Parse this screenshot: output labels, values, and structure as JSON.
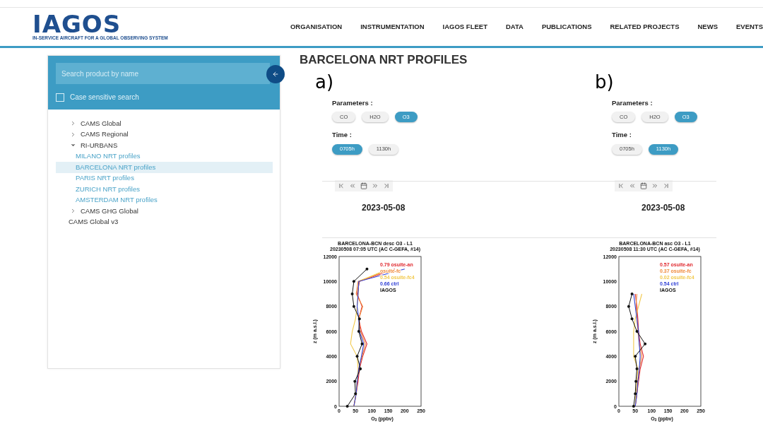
{
  "header": {
    "logo": {
      "name": "IAGOS",
      "tagline": "IN-SERVICE AIRCRAFT FOR A GLOBAL OBSERVING SYSTEM"
    },
    "nav": [
      "ORGANISATION",
      "INSTRUMENTATION",
      "IAGOS FLEET",
      "DATA",
      "PUBLICATIONS",
      "RELATED PROJECTS",
      "NEWS",
      "EVENTS"
    ]
  },
  "sidebar": {
    "search": {
      "placeholder": "Search product by name"
    },
    "case_sensitive": {
      "label": "Case sensitive search",
      "checked": false
    },
    "tree": [
      {
        "label": "CAMS Global",
        "expanded": false,
        "selected": false
      },
      {
        "label": "CAMS Regional",
        "expanded": false,
        "selected": false
      },
      {
        "label": "RI-URBANS",
        "expanded": true,
        "selected": false,
        "children": [
          {
            "label": "MILANO NRT profiles",
            "selected": false
          },
          {
            "label": "BARCELONA NRT profiles",
            "selected": true
          },
          {
            "label": "PARIS NRT profiles",
            "selected": false
          },
          {
            "label": "ZURICH NRT profiles",
            "selected": false
          },
          {
            "label": "AMSTERDAM NRT profiles",
            "selected": false
          }
        ]
      },
      {
        "label": "CAMS GHG Global",
        "expanded": false,
        "selected": false
      },
      {
        "label": "CAMS Global v3",
        "selected": false
      }
    ]
  },
  "page_title": "BARCELONA NRT PROFILES",
  "panels": [
    {
      "label": "a)",
      "parameters_label": "Parameters :",
      "parameters": [
        {
          "label": "CO",
          "selected": false
        },
        {
          "label": "H2O",
          "selected": false
        },
        {
          "label": "O3",
          "selected": true
        }
      ],
      "time_label": "Time :",
      "times": [
        {
          "label": "0705h",
          "selected": true
        },
        {
          "label": "1130h",
          "selected": false
        }
      ],
      "date": "2023-05-08",
      "chart_data": {
        "type": "line",
        "title": "BARCELONA-BCN desc O3 - L1",
        "subtitle": "20230508 07:05 UTC (AC C-GEFA, #14)",
        "orientation": "horizontal",
        "xlabel": "O$_{3}$ (ppbv)",
        "ylabel": "z (m a.s.l.)",
        "xlim": [
          0,
          250
        ],
        "ylim": [
          0,
          12000
        ],
        "xticks": [
          0,
          50,
          100,
          150,
          200,
          250
        ],
        "yticks": [
          0,
          2000,
          4000,
          6000,
          8000,
          10000,
          12000
        ],
        "x": [
          0,
          1000,
          2000,
          3000,
          4000,
          5000,
          6000,
          7000,
          8000,
          9000,
          10000,
          11000
        ],
        "series": [
          {
            "name": "0.79  osuite-an",
            "color": "#e0282e",
            "values": [
              45,
              52,
              58,
              62,
              72,
              85,
              68,
              60,
              70,
              55,
              62,
              170
            ]
          },
          {
            "name": "osuite-fc",
            "color": "#f08a3c",
            "values": [
              45,
              52,
              55,
              60,
              70,
              80,
              65,
              60,
              72,
              52,
              58,
              160
            ]
          },
          {
            "name": "0.54  osuite-fc4",
            "color": "#f2c94c",
            "values": [
              45,
              52,
              55,
              58,
              55,
              35,
              40,
              50,
              55,
              58,
              60,
              150
            ]
          },
          {
            "name": "0.66  ctrl",
            "color": "#2f3fd6",
            "values": [
              45,
              52,
              55,
              60,
              68,
              75,
              62,
              60,
              55,
              58,
              60,
              200
            ]
          },
          {
            "name": "IAGOS",
            "color": "#111111",
            "values": [
              25,
              50,
              48,
              65,
              55,
              70,
              60,
              62,
              45,
              40,
              45,
              85
            ]
          }
        ]
      }
    },
    {
      "label": "b)",
      "parameters_label": "Parameters :",
      "parameters": [
        {
          "label": "CO",
          "selected": false
        },
        {
          "label": "H2O",
          "selected": false
        },
        {
          "label": "O3",
          "selected": true
        }
      ],
      "time_label": "Time :",
      "times": [
        {
          "label": "0705h",
          "selected": false
        },
        {
          "label": "1130h",
          "selected": true
        }
      ],
      "date": "2023-05-08",
      "chart_data": {
        "type": "line",
        "title": "BARCELONA-BCN asc O3 - L1",
        "subtitle": "20230508 11:30 UTC (AC C-GEFA, #14)",
        "orientation": "horizontal",
        "xlabel": "O$_{3}$ (ppbv)",
        "ylabel": "z (m a.s.l.)",
        "xlim": [
          0,
          250
        ],
        "ylim": [
          0,
          12000
        ],
        "xticks": [
          0,
          50,
          100,
          150,
          200,
          250
        ],
        "yticks": [
          0,
          2000,
          4000,
          6000,
          8000,
          10000,
          12000
        ],
        "x": [
          0,
          1000,
          2000,
          3000,
          4000,
          5000,
          6000,
          7000,
          8000,
          9000
        ],
        "series": [
          {
            "name": "0.57  osuite-an",
            "color": "#e0282e",
            "values": [
              50,
              55,
              60,
              65,
              75,
              65,
              60,
              58,
              55,
              50
            ]
          },
          {
            "name": "0.37  osuite-fc",
            "color": "#f08a3c",
            "values": [
              50,
              55,
              58,
              62,
              70,
              62,
              58,
              55,
              52,
              55
            ]
          },
          {
            "name": "0.02  osuite-fc4",
            "color": "#f2c94c",
            "values": [
              50,
              52,
              55,
              58,
              45,
              45,
              45,
              50,
              60,
              70
            ]
          },
          {
            "name": "0.54  ctrl",
            "color": "#2f3fd6",
            "values": [
              50,
              55,
              58,
              62,
              65,
              62,
              60,
              55,
              50,
              45
            ]
          },
          {
            "name": "IAGOS",
            "color": "#111111",
            "values": [
              45,
              50,
              52,
              55,
              50,
              80,
              55,
              40,
              30,
              40
            ]
          }
        ]
      }
    }
  ]
}
